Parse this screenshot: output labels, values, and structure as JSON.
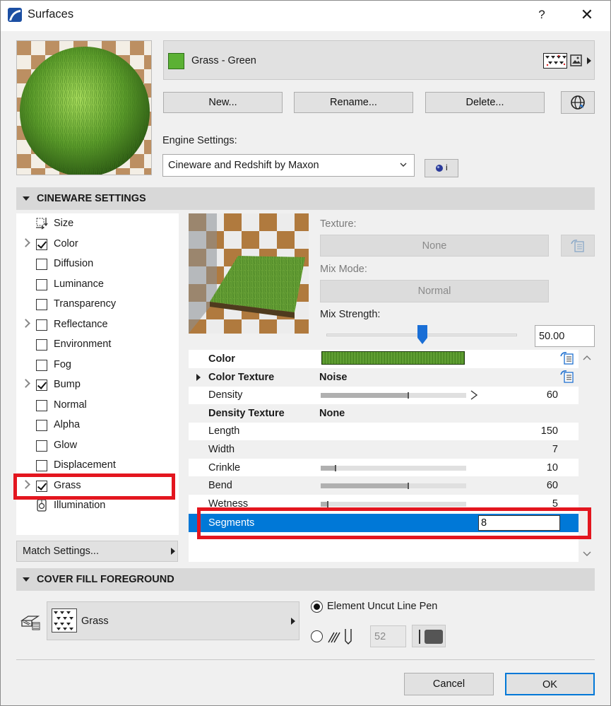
{
  "window": {
    "title": "Surfaces",
    "help_label": "?",
    "close_label": "✕"
  },
  "surface": {
    "name": "Grass - Green",
    "swatch_color": "#5bb134"
  },
  "buttons": {
    "new": "New...",
    "rename": "Rename...",
    "delete": "Delete...",
    "match_settings": "Match Settings...",
    "cancel": "Cancel",
    "ok": "OK"
  },
  "engine": {
    "label": "Engine Settings:",
    "value": "Cineware and Redshift by Maxon",
    "info_label": "i"
  },
  "cineware": {
    "header": "CINEWARE SETTINGS",
    "channels": [
      {
        "label": "Size",
        "type": "icon",
        "expander": false,
        "checked": false
      },
      {
        "label": "Color",
        "type": "checkbox",
        "expander": true,
        "checked": true
      },
      {
        "label": "Diffusion",
        "type": "checkbox",
        "expander": false,
        "checked": false
      },
      {
        "label": "Luminance",
        "type": "checkbox",
        "expander": false,
        "checked": false
      },
      {
        "label": "Transparency",
        "type": "checkbox",
        "expander": false,
        "checked": false
      },
      {
        "label": "Reflectance",
        "type": "checkbox",
        "expander": true,
        "checked": false
      },
      {
        "label": "Environment",
        "type": "checkbox",
        "expander": false,
        "checked": false
      },
      {
        "label": "Fog",
        "type": "checkbox",
        "expander": false,
        "checked": false
      },
      {
        "label": "Bump",
        "type": "checkbox",
        "expander": true,
        "checked": true
      },
      {
        "label": "Normal",
        "type": "checkbox",
        "expander": false,
        "checked": false
      },
      {
        "label": "Alpha",
        "type": "checkbox",
        "expander": false,
        "checked": false
      },
      {
        "label": "Glow",
        "type": "checkbox",
        "expander": false,
        "checked": false
      },
      {
        "label": "Displacement",
        "type": "checkbox",
        "expander": false,
        "checked": false
      },
      {
        "label": "Grass",
        "type": "checkbox",
        "expander": true,
        "checked": true
      },
      {
        "label": "Illumination",
        "type": "icon",
        "expander": false,
        "checked": false
      }
    ],
    "texture_label": "Texture:",
    "texture_value": "None",
    "mix_mode_label": "Mix Mode:",
    "mix_mode_value": "Normal",
    "mix_strength_label": "Mix Strength:",
    "mix_strength_value": "50.00",
    "mix_strength_fraction": 0.5
  },
  "properties": [
    {
      "name": "Color",
      "bold": true,
      "kind": "color"
    },
    {
      "name": "Color Texture",
      "bold": true,
      "value": "Noise",
      "expand": true
    },
    {
      "name": "Density",
      "number": "60",
      "bar": 0.6
    },
    {
      "name": "Density Texture",
      "bold": true,
      "value": "None"
    },
    {
      "name": "Length",
      "number": "150"
    },
    {
      "name": "Width",
      "number": "7"
    },
    {
      "name": "Crinkle",
      "number": "10",
      "bar": 0.1
    },
    {
      "name": "Bend",
      "number": "60",
      "bar": 0.6
    },
    {
      "name": "Wetness",
      "number": "5",
      "bar": 0.05
    },
    {
      "name": "Segments",
      "number": "8",
      "selected": true
    }
  ],
  "cover_fill": {
    "header": "COVER FILL FOREGROUND",
    "fill_name": "Grass",
    "radio_label": "Element Uncut Line Pen",
    "pen_number": "52"
  },
  "colors": {
    "highlight_red": "#e3161f",
    "selection_blue": "#0078d7",
    "grass_green": "#5bb134"
  }
}
